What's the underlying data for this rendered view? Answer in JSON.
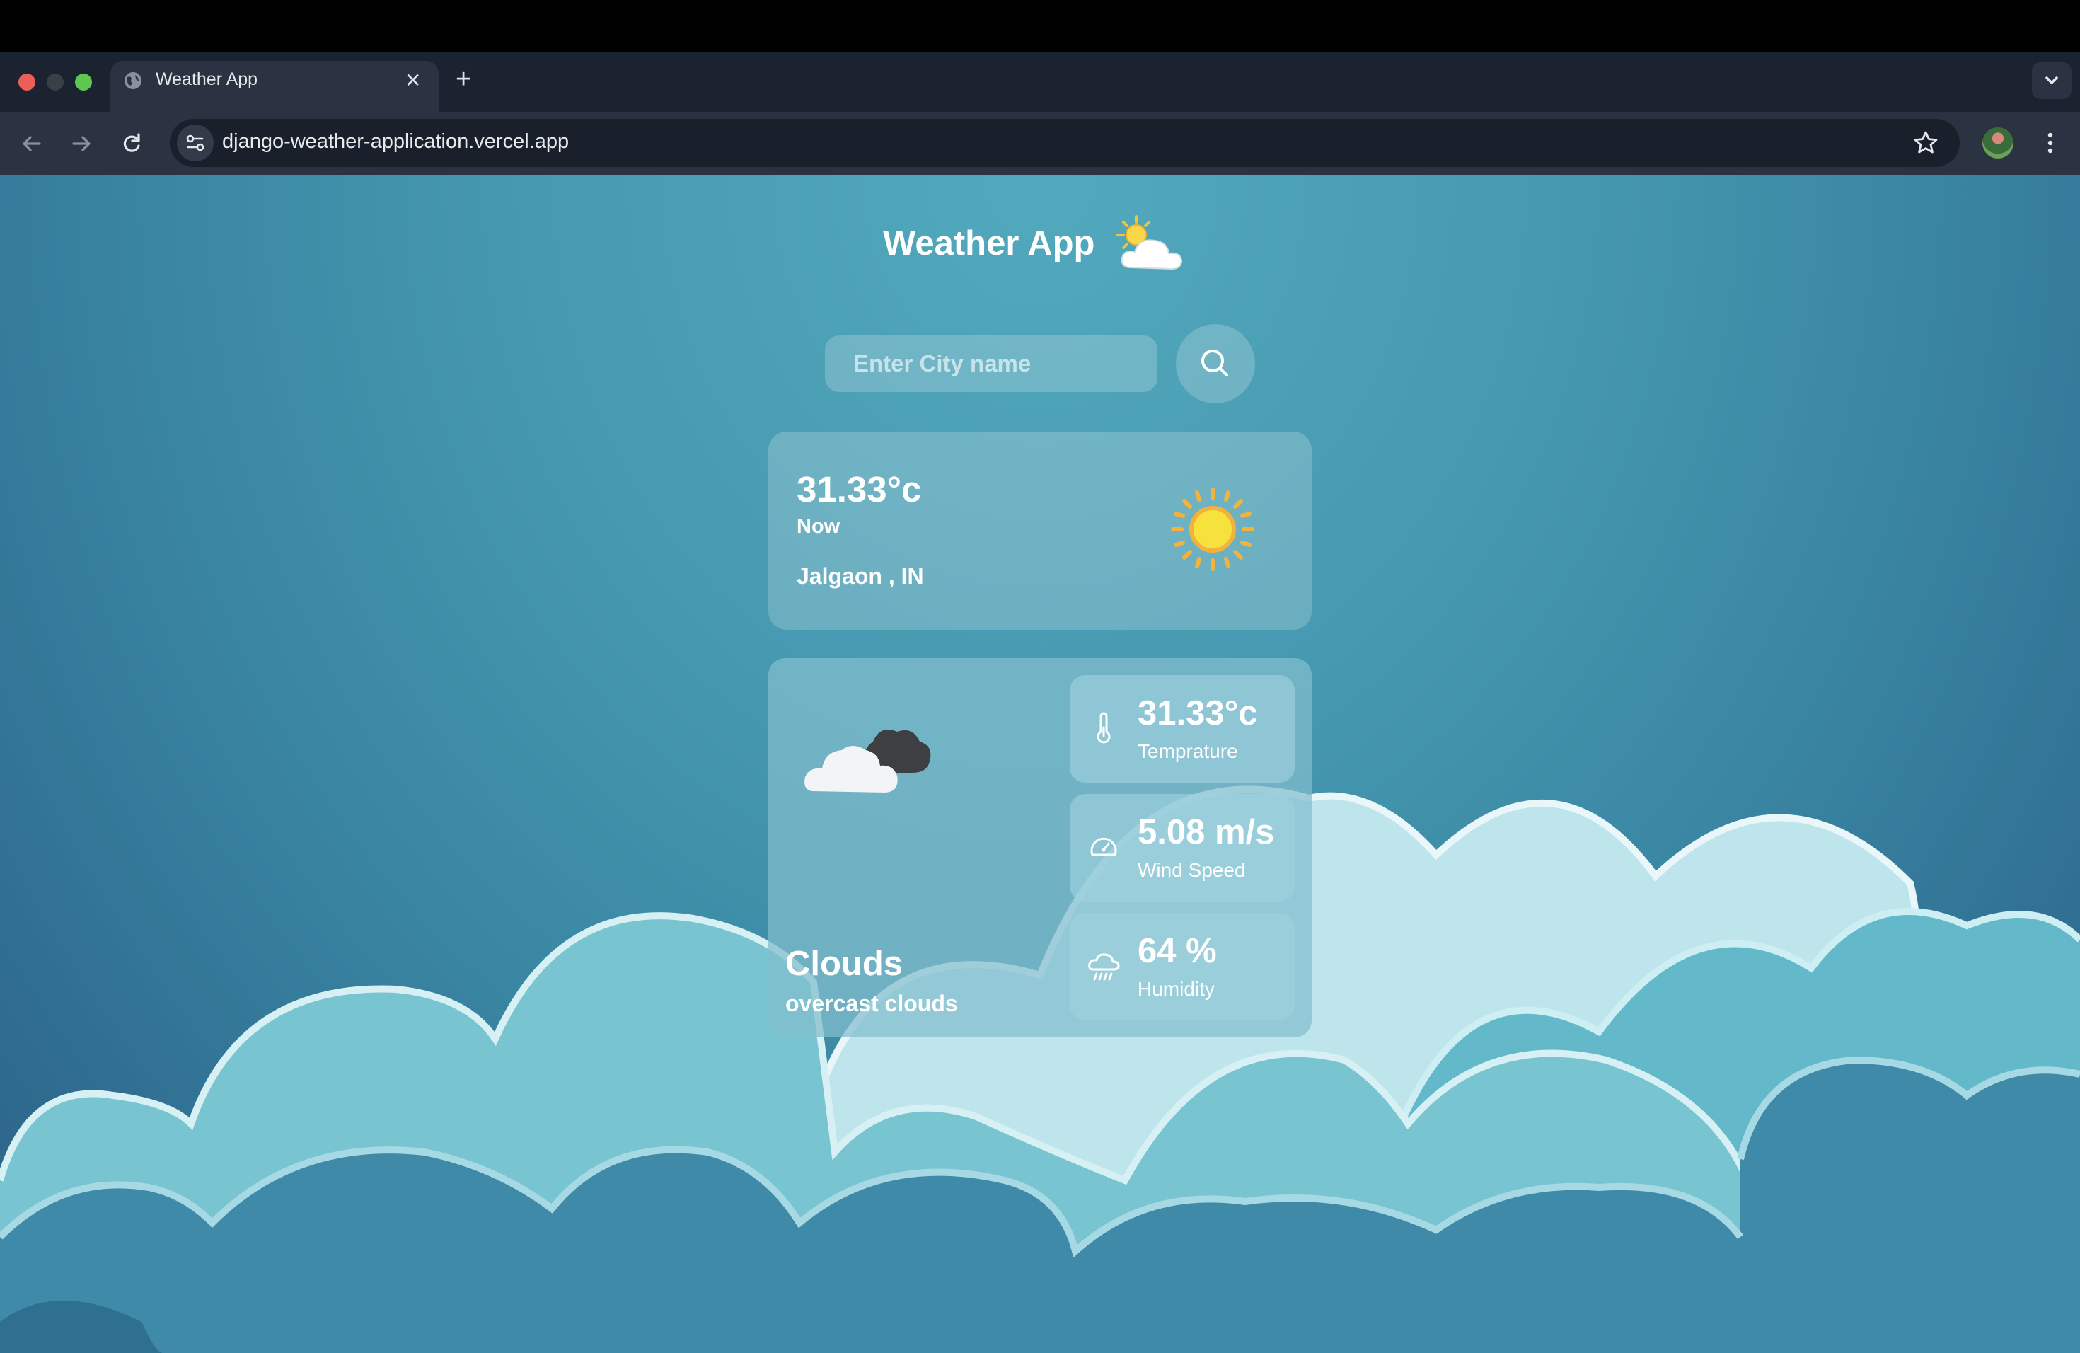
{
  "browser": {
    "tab_title": "Weather App",
    "url": "django-weather-application.vercel.app",
    "icons": [
      "globe-icon",
      "close-icon",
      "plus-icon",
      "chevron-down-icon",
      "back-arrow-icon",
      "forward-arrow-icon",
      "reload-icon",
      "site-settings-icon",
      "star-icon",
      "avatar",
      "kebab-menu-icon"
    ]
  },
  "app": {
    "title": "Weather App",
    "title_icon": "sun-behind-cloud-icon"
  },
  "search": {
    "placeholder": "Enter City name",
    "button_icon": "search-icon"
  },
  "current": {
    "temperature": "31.33°c",
    "time_label": "Now",
    "location": "Jalgaon , IN",
    "icon": "sun-icon"
  },
  "details": {
    "condition": "Clouds",
    "description": "overcast clouds",
    "condition_icon": "cloud-icon",
    "stats": [
      {
        "value": "31.33°c",
        "label": "Temprature",
        "icon": "thermometer-icon"
      },
      {
        "value": "5.08 m/s",
        "label": "Wind Speed",
        "icon": "gauge-icon"
      },
      {
        "value": "64 %",
        "label": "Humidity",
        "icon": "rain-cloud-icon"
      }
    ]
  },
  "colors": {
    "bg_top": "#52a9bd",
    "bg_bottom": "#2a5f86",
    "chrome_dark": "#1b2230",
    "chrome_toolbar": "#2b3241",
    "sun": "#f6c53a"
  }
}
